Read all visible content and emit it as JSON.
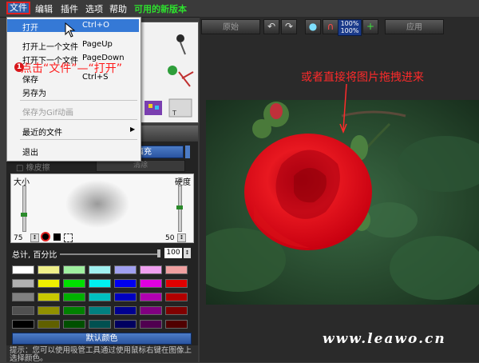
{
  "menubar": {
    "file": "文件",
    "edit": "编辑",
    "plugins": "插件",
    "options": "选项",
    "help": "帮助",
    "new_version": "可用的新版本"
  },
  "toolbar": {
    "original": "原始",
    "zoom_top": "100%",
    "zoom_bottom": "100%",
    "apply": "应用",
    "icons": [
      "undo-icon",
      "redo-icon",
      "zoom-in-icon",
      "magnet-icon",
      "add-icon"
    ]
  },
  "file_menu": {
    "items": [
      {
        "label": "打开",
        "shortcut": "Ctrl+O"
      },
      {
        "label": "打开上一个文件",
        "shortcut": "PageUp"
      },
      {
        "label": "打开下一个文件",
        "shortcut": "PageDown"
      },
      {
        "label": "保存",
        "shortcut": "Ctrl+S"
      },
      {
        "label": "另存为",
        "shortcut": ""
      },
      {
        "label": "保存为Gif动画",
        "shortcut": ""
      },
      {
        "label": "最近的文件",
        "shortcut": ""
      },
      {
        "label": "退出",
        "shortcut": ""
      }
    ]
  },
  "annotation": {
    "step": "1",
    "callout": "点击“文件”—“打开”",
    "drag_hint": "或者直接将图片拖拽进来"
  },
  "brush_panel": {
    "fill_button": "填充",
    "eraser_label": "橡皮擦",
    "clear_button": "清除",
    "size_label": "大小",
    "hardness_label": "硬度",
    "size_value": "75",
    "hardness_value": "50",
    "total_label": "总计, 百分比",
    "total_value": "100",
    "default_colors_button": "默认颜色",
    "hint": "提示：您可以使用吸管工具通过使用鼠标右键在图像上选择颜色。"
  },
  "swatch_colors": [
    [
      "#ffffff",
      "#f0f08a",
      "#a0f0a0",
      "#a0f0f0",
      "#a0a0f0",
      "#f0a0f0",
      "#f0a0a0"
    ],
    [
      "#b0b0b0",
      "#f0f000",
      "#00e000",
      "#00f0f0",
      "#0000f0",
      "#e000e0",
      "#e00000"
    ],
    [
      "#808080",
      "#c8c800",
      "#00b000",
      "#00c0c0",
      "#0000c0",
      "#b000b0",
      "#b00000"
    ],
    [
      "#505050",
      "#909000",
      "#008000",
      "#008080",
      "#000090",
      "#800080",
      "#800000"
    ],
    [
      "#000000",
      "#606000",
      "#005000",
      "#005050",
      "#000060",
      "#500050",
      "#500000"
    ]
  ],
  "watermark": "www.leawo.cn"
}
